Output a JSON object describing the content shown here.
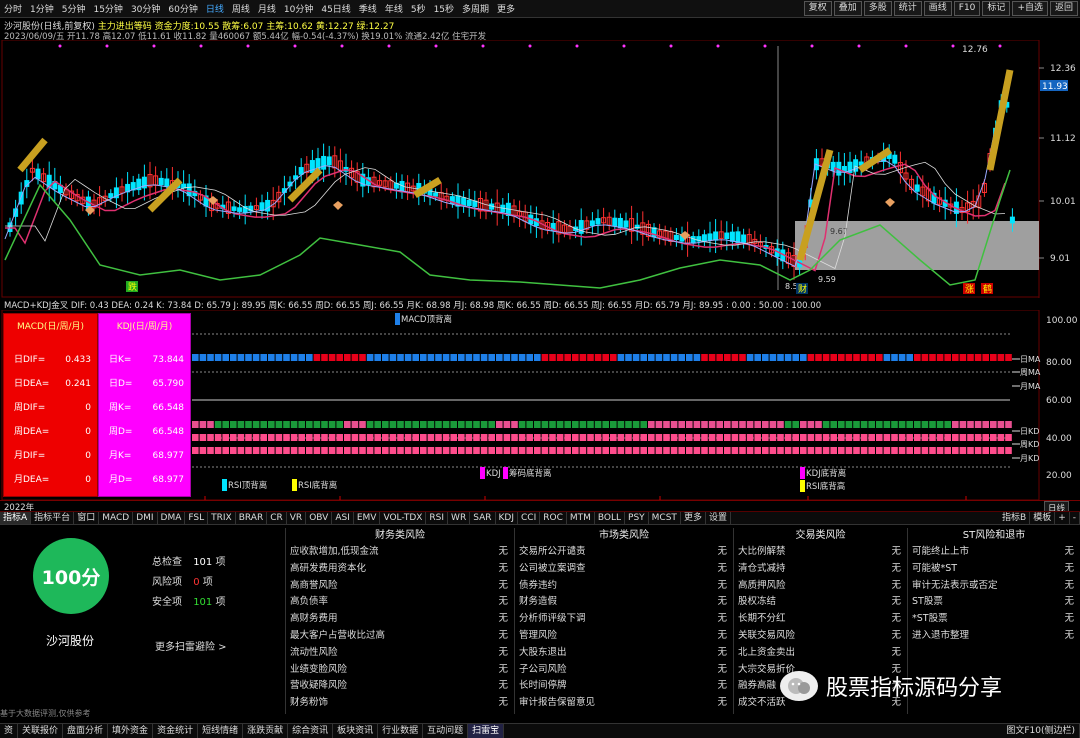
{
  "toolbar": {
    "periods": [
      "分时",
      "1分钟",
      "5分钟",
      "15分钟",
      "30分钟",
      "60分钟",
      "日线",
      "周线",
      "月线",
      "10分钟",
      "45日线",
      "季线",
      "年线",
      "5秒",
      "15秒",
      "多周期",
      "更多"
    ],
    "active_period": "日线",
    "right_buttons": [
      "复权",
      "叠加",
      "多股",
      "统计",
      "画线",
      "F10",
      "标记",
      "+自选",
      "返回"
    ]
  },
  "main_chart": {
    "title": "沙河股份(日线,前复权)",
    "indicator_line": "主力进出等码 资金力度:10.55 散筹:6.07 主筹:10.62 黄:12.27 绿:12.27",
    "info_line": "2023/06/09/五 开11.78 高12.07 低11.61 收11.82 量460067 额5.44亿 幅-0.54(-4.37%) 换19.01% 流通2.42亿 住宅开发",
    "price_ticks": [
      "12.36",
      "11.12",
      "10.01",
      "9.01"
    ],
    "current_price": "11.93",
    "hi_label": "12.76",
    "lo_label1": "9.59",
    "lo_label2": "8.53",
    "mid_label": "9.67",
    "marks": [
      "跌",
      "财",
      "涨",
      "鹤"
    ]
  },
  "indicator": {
    "header": "MACD+KDJ金叉 DIF: 0.43 DEA: 0.24 K: 73.84 D: 65.79 J: 89.95 周K: 66.55 周D: 66.55 周J: 66.55 月K: 68.98 月J: 68.98 周K: 66.55 周D: 66.55 周J: 66.55 月D: 65.79 月J: 89.95 : 0.00 : 50.00 : 100.00",
    "macd_title": "MACD(日/周/月)",
    "kdj_title": "KDJ(日/周/月)",
    "macd_rows": [
      [
        "日DIF=",
        "0.433"
      ],
      [
        "日DEA=",
        "0.241"
      ],
      [
        "周DIF=",
        "0"
      ],
      [
        "周DEA=",
        "0"
      ],
      [
        "月DIF=",
        "0"
      ],
      [
        "月DEA=",
        "0"
      ]
    ],
    "kdj_rows": [
      [
        "日K=",
        "73.844"
      ],
      [
        "日D=",
        "65.790"
      ],
      [
        "周K=",
        "66.548"
      ],
      [
        "周D=",
        "66.548"
      ],
      [
        "月K=",
        "68.977"
      ],
      [
        "月D=",
        "68.977"
      ]
    ],
    "ticks": [
      "100.00",
      "80.00",
      "60.00",
      "40.00",
      "20.00"
    ],
    "right_labels": [
      "日MA",
      "周MA",
      "月MA",
      "日KD",
      "周KD",
      "月KD"
    ],
    "labels": [
      "MACD顶背离",
      "RSI顶背离",
      "RSI底背离",
      "KDJ",
      "筹码底背离",
      "KDJ底背离",
      "RSI底背高"
    ],
    "year_label": "2022年",
    "x_ticks": [
      "1",
      "2",
      "3",
      "4",
      "5",
      "6"
    ]
  },
  "tabs": [
    "指标A",
    "指标平台",
    "窗口",
    "MACD",
    "DMI",
    "DMA",
    "FSL",
    "TRIX",
    "BRAR",
    "CR",
    "VR",
    "OBV",
    "ASI",
    "EMV",
    "VOL-TDX",
    "RSI",
    "WR",
    "SAR",
    "KDJ",
    "CCI",
    "ROC",
    "MTM",
    "BOLL",
    "PSY",
    "MCST",
    "更多",
    "设置"
  ],
  "tabs_right": [
    "指标B",
    "模板",
    "+",
    "-"
  ],
  "active_tab": "指标A",
  "risk": {
    "score": "100分",
    "stock": "沙河股份",
    "total_label": "总检查",
    "total": "101",
    "unit": "项",
    "risk_label": "风险项",
    "risk_count": "0",
    "safe_label": "安全项",
    "safe": "101",
    "more": "更多扫雷避险 >",
    "footnote": "基于大数据评测,仅供参考"
  },
  "sections": [
    {
      "title": "财务类风险",
      "items": [
        "应收款增加,低现金流",
        "高研发费用资本化",
        "高商誉风险",
        "高负债率",
        "高财务费用",
        "最大客户占营收比过高",
        "流动性风险",
        "业绩变脸风险",
        "营收疑降风险",
        "财务粉饰"
      ]
    },
    {
      "title": "市场类风险",
      "items": [
        "交易所公开谴责",
        "公司被立案调查",
        "债券违约",
        "财务造假",
        "分析师评级下调",
        "管理风险",
        "大股东退出",
        "子公司风险",
        "长时间停牌",
        "审计报告保留意见"
      ]
    },
    {
      "title": "交易类风险",
      "items": [
        "大比例解禁",
        "清仓式减持",
        "高质押风险",
        "股权冻结",
        "长期不分红",
        "关联交易风险",
        "北上资金卖出",
        "大宗交易折价",
        "融券高融",
        "成交不活跃"
      ]
    },
    {
      "title": "ST风险和退市",
      "items": [
        "可能终止上市",
        "可能被*ST",
        "审计无法表示或否定",
        "ST股票",
        "*ST股票",
        "进入退市整理"
      ]
    }
  ],
  "none_label": "无",
  "bottom_tabs": [
    "资",
    "关联报价",
    "盘面分析",
    "填外资金",
    "资金统计",
    "短线情绪",
    "涨跌贡献",
    "综合资讯",
    "板块资讯",
    "行业数据",
    "互动问题",
    "扫雷宝"
  ],
  "bottom_right": "图文F10(侧边栏)",
  "watermark": "股票指标源码分享",
  "colors": {
    "up": "#ff3030",
    "down": "#00e5ff",
    "gold": "#c8a020",
    "kdj_green": "#40c040",
    "macd_red": "#e8001a",
    "kdj_magenta": "#ff40ff"
  }
}
